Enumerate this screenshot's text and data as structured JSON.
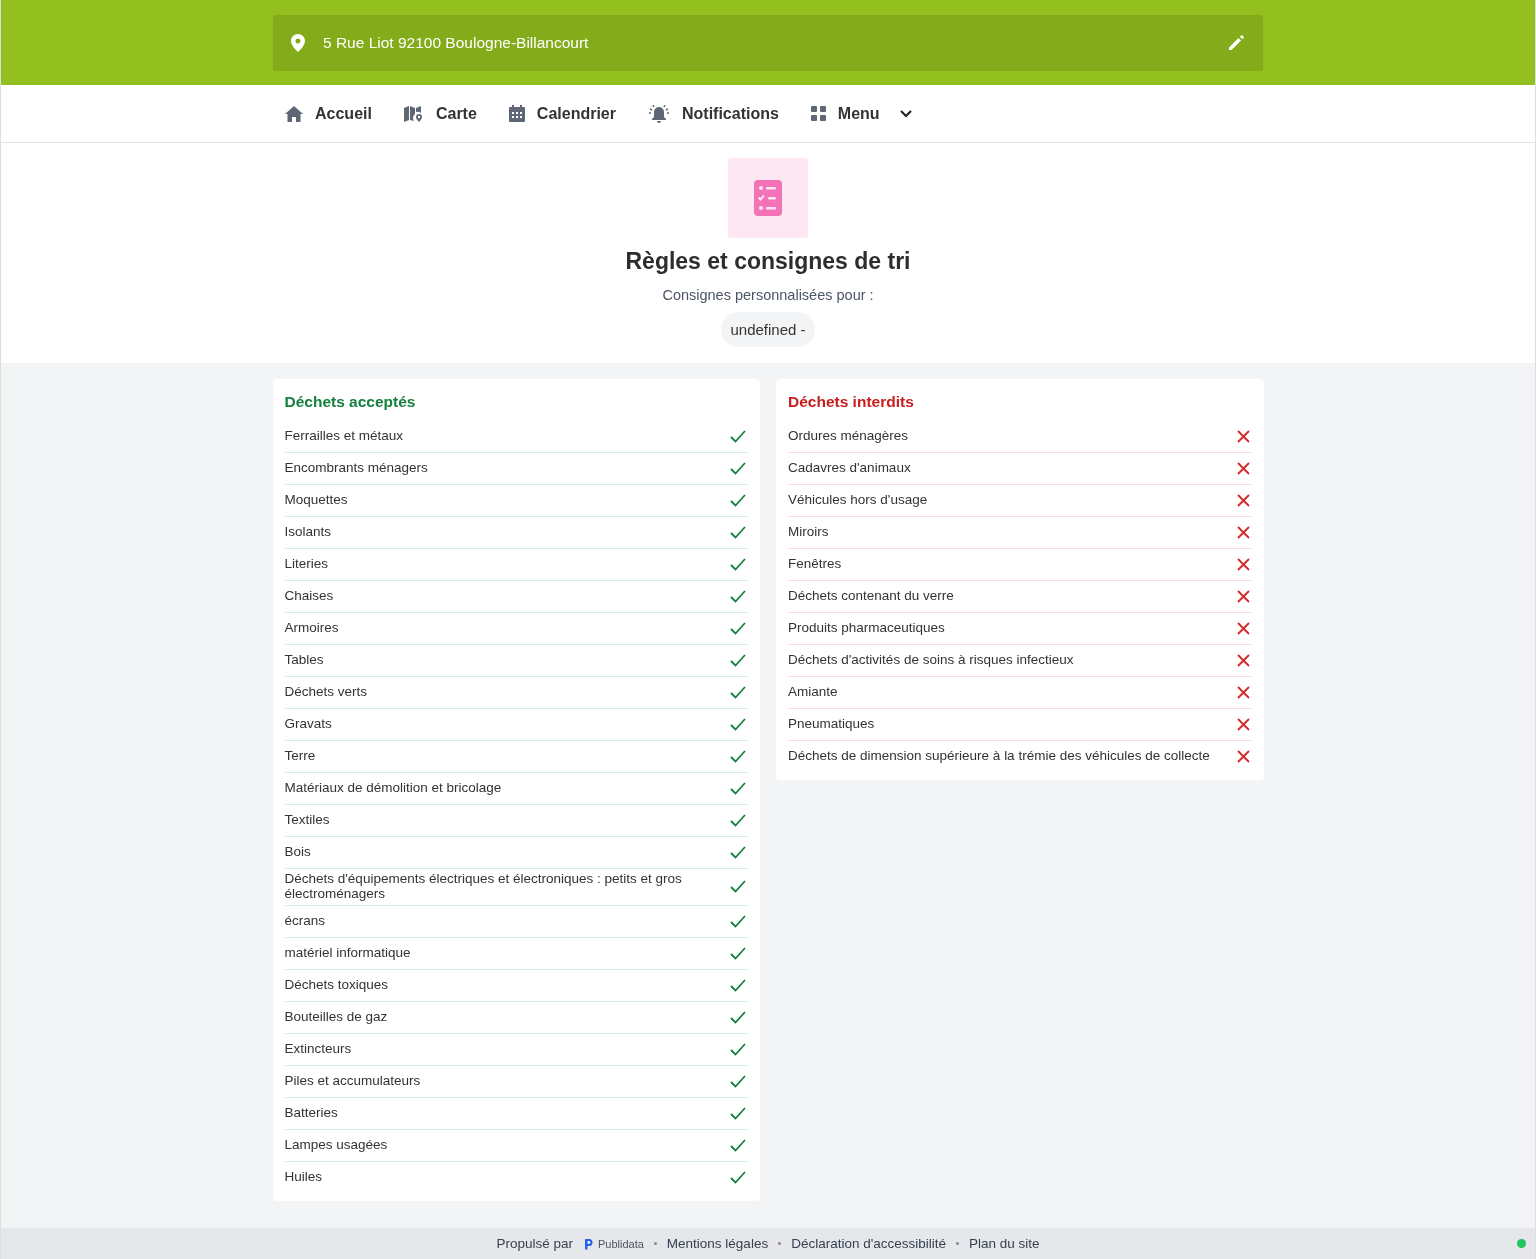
{
  "address_bar": {
    "address": "5 Rue Liot 92100 Boulogne-Billancourt"
  },
  "nav": [
    {
      "label": "Accueil",
      "kind": "home"
    },
    {
      "label": "Carte",
      "kind": "map"
    },
    {
      "label": "Calendrier",
      "kind": "calendar"
    },
    {
      "label": "Notifications",
      "kind": "bell"
    },
    {
      "label": "Menu",
      "kind": "menu"
    }
  ],
  "header": {
    "title": "Règles et consignes de tri",
    "subtitle": "Consignes personnalisées pour :",
    "chip": "undefined -"
  },
  "panels": [
    {
      "title": "Déchets acceptés",
      "kind": "accepted",
      "items": [
        "Ferrailles et métaux",
        "Encombrants ménagers",
        "Moquettes",
        "Isolants",
        "Literies",
        "Chaises",
        "Armoires",
        "Tables",
        "Déchets verts",
        "Gravats",
        "Terre",
        "Matériaux de démolition et bricolage",
        "Textiles",
        "Bois",
        "Déchets d'équipements électriques et électroniques : petits et gros électroménagers",
        "écrans",
        "matériel informatique",
        "Déchets toxiques",
        "Bouteilles de gaz",
        "Extincteurs",
        "Piles et accumulateurs",
        "Batteries",
        "Lampes usagées",
        "Huiles"
      ]
    },
    {
      "title": "Déchets interdits",
      "kind": "forbidden",
      "items": [
        "Ordures ménagères",
        "Cadavres d'animaux",
        "Véhicules hors d'usage",
        "Miroirs",
        "Fenêtres",
        "Déchets contenant du verre",
        "Produits pharmaceutiques",
        "Déchets d'activités de soins à risques infectieux",
        "Amiante",
        "Pneumatiques",
        "Déchets de dimension supérieure à la trémie des véhicules de collecte"
      ]
    }
  ],
  "footer": {
    "powered_by": "Propulsé par",
    "brand": "Publidata",
    "links": [
      "Mentions légales",
      "Déclaration d'accessibilité",
      "Plan du site"
    ]
  }
}
